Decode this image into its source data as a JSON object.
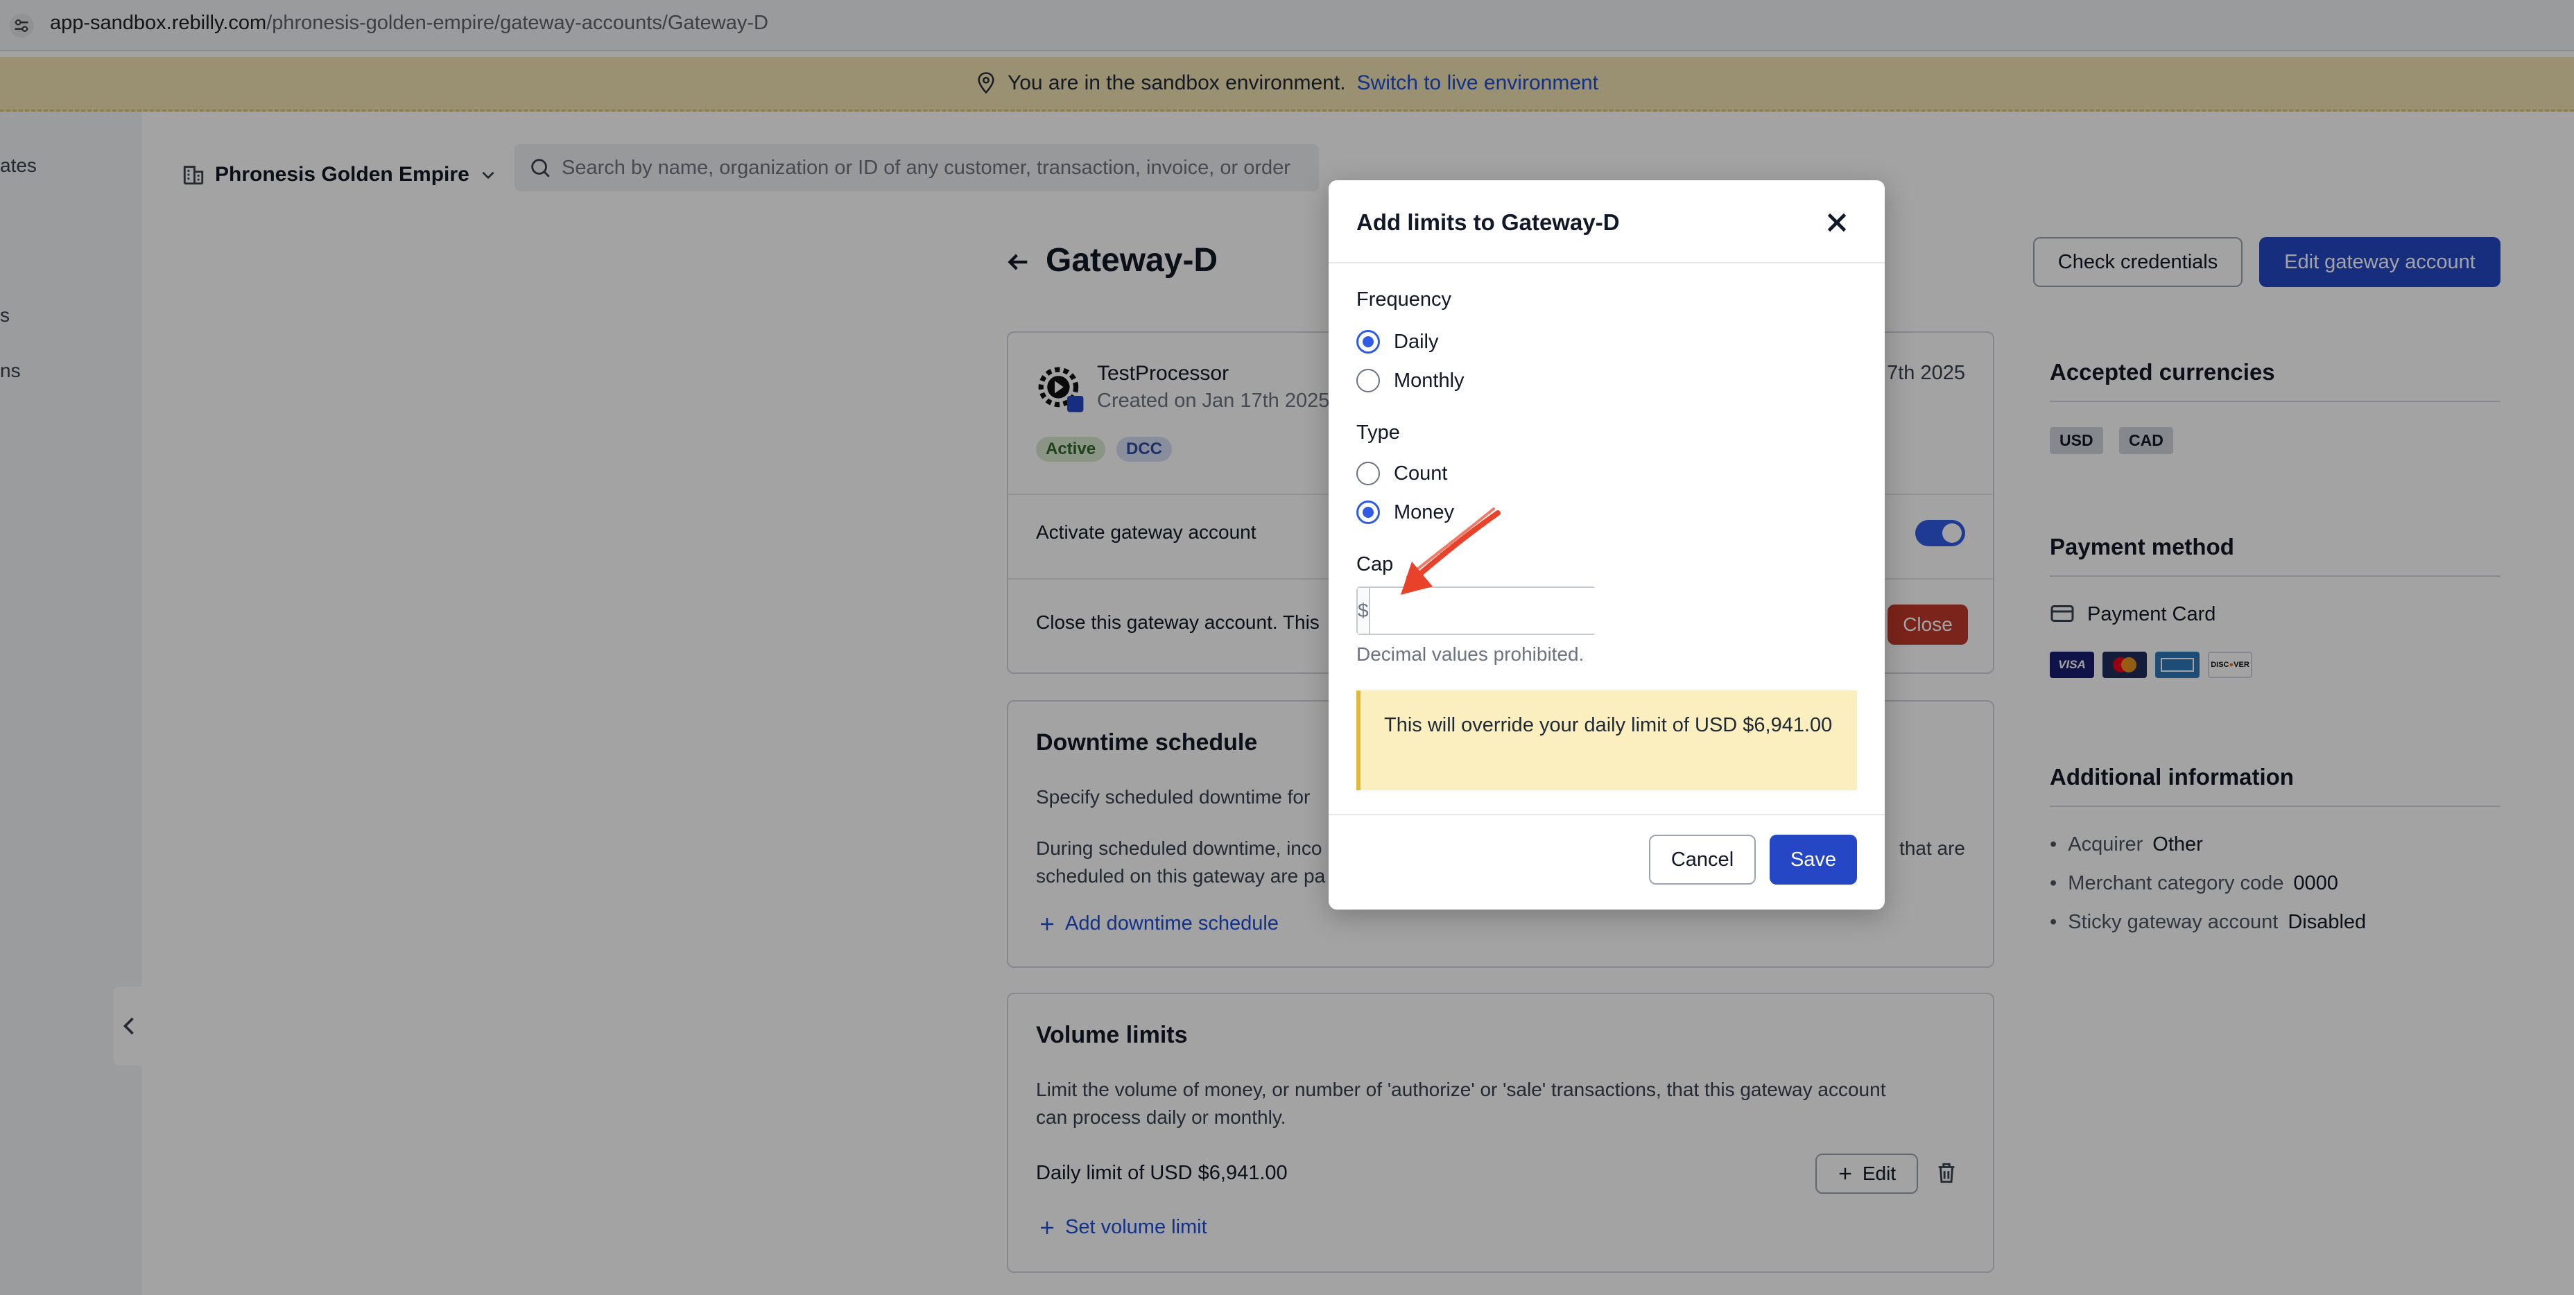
{
  "browser": {
    "url_host": "app-sandbox.rebilly.com",
    "url_path": "/phronesis-golden-empire/gateway-accounts/Gateway-D"
  },
  "banner": {
    "text": "You are in the sandbox environment.",
    "link": "Switch to live environment"
  },
  "left_rail": {
    "fragments": [
      "ates",
      "s",
      "ns"
    ]
  },
  "header": {
    "org_name": "Phronesis Golden Empire",
    "search_placeholder": "Search by name, organization or ID of any customer, transaction, invoice, or order"
  },
  "page": {
    "title": "Gateway-D",
    "check_credentials": "Check credentials",
    "edit_gateway_account": "Edit gateway account"
  },
  "processor_card": {
    "name": "TestProcessor",
    "created": "Created on Jan 17th 2025",
    "date_right": "7th 2025",
    "badges": [
      "Active",
      "DCC"
    ],
    "activate_label": "Activate gateway account",
    "activate_on": true,
    "close_text": "Close this gateway account. This",
    "close_button": "Close"
  },
  "downtime_card": {
    "title": "Downtime schedule",
    "desc1": "Specify scheduled downtime for",
    "desc2_left": "During scheduled downtime, inco",
    "desc2_right": "that are",
    "desc3": "scheduled on this gateway are pa",
    "add_link": "Add downtime schedule"
  },
  "volume_card": {
    "title": "Volume limits",
    "desc_line1": "Limit the volume of money, or number of 'authorize' or 'sale' transactions, that this gateway account",
    "desc_line2": "can process daily or monthly.",
    "daily_limit": "Daily limit of USD $6,941.00",
    "edit": "Edit",
    "set_link": "Set volume limit"
  },
  "right_column": {
    "accepted_currencies_title": "Accepted currencies",
    "currencies": [
      "USD",
      "CAD"
    ],
    "payment_method_title": "Payment method",
    "payment_method": "Payment Card",
    "card_brands": [
      {
        "name": "VISA",
        "color": "#1a1f71"
      },
      {
        "name": "MC",
        "color": "#1f2d5a"
      },
      {
        "name": "AMEX",
        "color": "#2e77bb"
      },
      {
        "name": "DISCOVER",
        "color": "#ffffff"
      }
    ],
    "additional_info_title": "Additional information",
    "info": [
      {
        "label": "Acquirer",
        "value": "Other"
      },
      {
        "label": "Merchant category code",
        "value": "0000"
      },
      {
        "label": "Sticky gateway account",
        "value": "Disabled"
      }
    ]
  },
  "modal": {
    "title": "Add limits to Gateway-D",
    "frequency_label": "Frequency",
    "frequency_options": [
      {
        "label": "Daily",
        "selected": true
      },
      {
        "label": "Monthly",
        "selected": false
      }
    ],
    "type_label": "Type",
    "type_options": [
      {
        "label": "Count",
        "selected": false
      },
      {
        "label": "Money",
        "selected": true
      }
    ],
    "cap_label": "Cap",
    "cap_prefix": "$",
    "cap_value": "",
    "cap_help": "Decimal values prohibited.",
    "warning": "This will override your daily limit of USD $6,941.00",
    "cancel": "Cancel",
    "save": "Save"
  },
  "colors": {
    "primary": "#2547c6",
    "danger": "#c0392b",
    "banner_bg": "#efe3b3",
    "warning_bg": "#fbefbf",
    "annotation_arrow": "#e8432a"
  }
}
